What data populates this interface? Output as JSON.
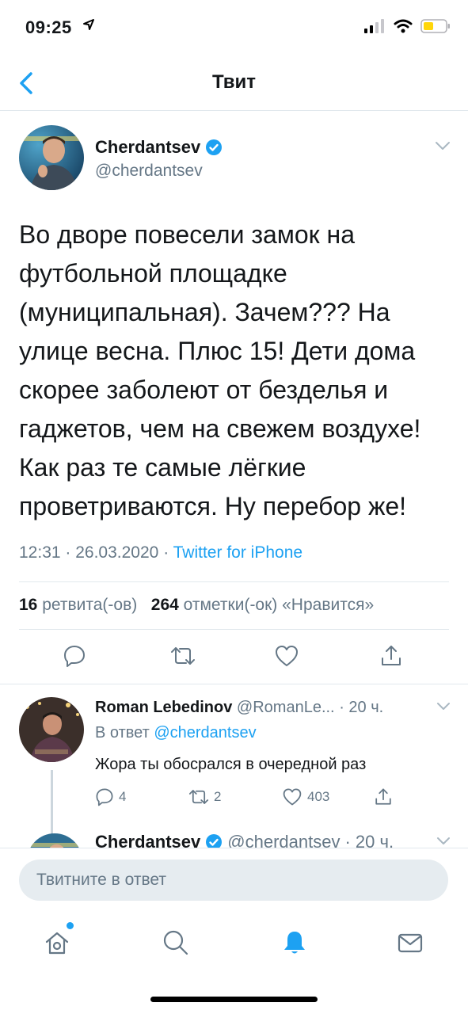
{
  "status_bar": {
    "time": "09:25"
  },
  "nav": {
    "title": "Твит"
  },
  "tweet": {
    "author_name": "Cherdantsev",
    "author_handle": "@cherdantsev",
    "text": "Во дворе повесели замок на футбольной площадке (муниципальная). Зачем??? На улице весна. Плюс 15! Дети дома скорее заболеют от безделья и гаджетов, чем на свежем воздухе! Как раз те самые лёгкие проветриваются. Ну перебор же!",
    "time": "12:31",
    "date": "26.03.2020",
    "source": "Twitter for iPhone",
    "retweets_count": "16",
    "retweets_label": "ретвита(-ов)",
    "likes_count": "264",
    "likes_label": "отметки(-ок) «Нравится»"
  },
  "reply": {
    "author_name": "Roman Lebedinov",
    "author_handle": "@RomanLe...",
    "age": "· 20 ч.",
    "reply_to_prefix": "В ответ",
    "reply_to_handle": "@cherdantsev",
    "text": "Жора ты обосрался в очередной раз",
    "replies": "4",
    "retweets": "2",
    "likes": "403"
  },
  "next_tweet": {
    "author_name": "Cherdantsev",
    "author_handle": "@cherdantsev",
    "age": "· 20 ч."
  },
  "compose": {
    "placeholder": "Твитните в ответ"
  },
  "colors": {
    "accent": "#1da1f2",
    "muted": "#657786",
    "divider": "#e1e8ed"
  }
}
